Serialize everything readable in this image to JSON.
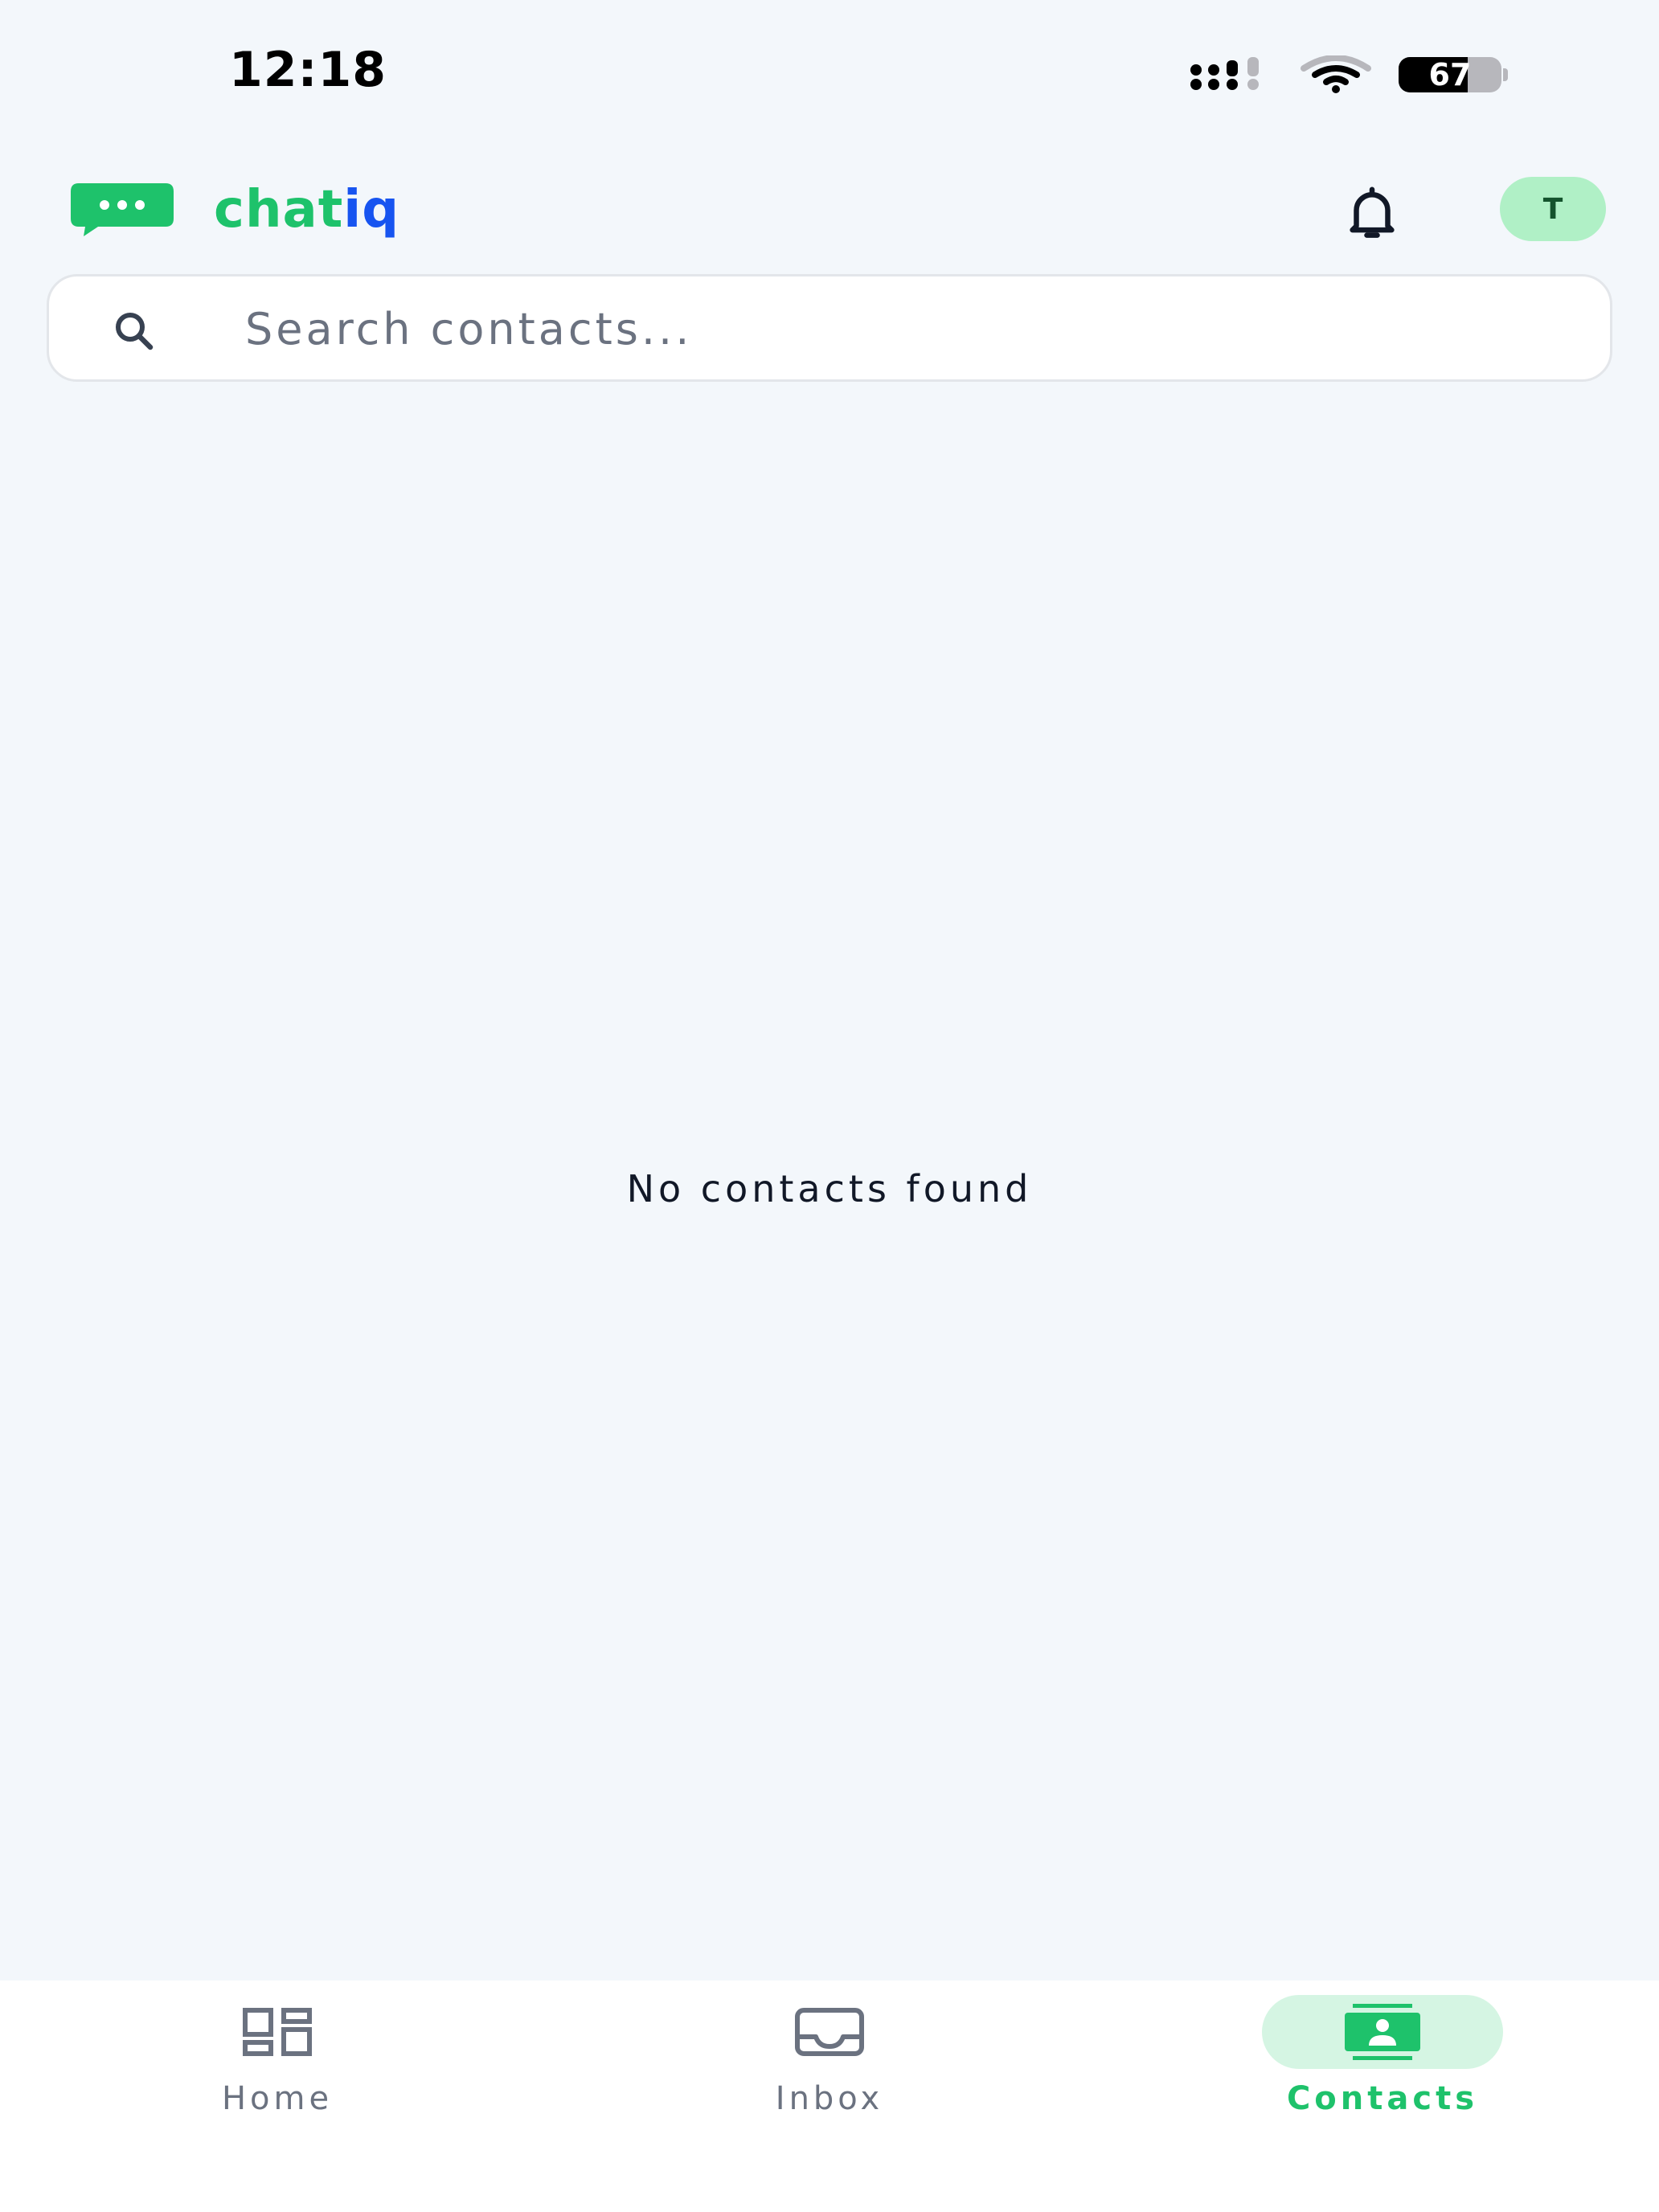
{
  "status_bar": {
    "time": "12:18",
    "battery_level": "67",
    "battery_fraction": 0.67,
    "icons": [
      "cellular-signal-icon",
      "wifi-icon",
      "battery-icon"
    ]
  },
  "header": {
    "brand_primary": "chat",
    "brand_accent": "iq",
    "logo_icon": "chat-bubble-icon",
    "notification_icon": "bell-icon",
    "avatar_initial": "T"
  },
  "search": {
    "icon": "search-icon",
    "placeholder": "Search contacts...",
    "value": ""
  },
  "main": {
    "empty_message": "No contacts found"
  },
  "bottom_nav": {
    "items": [
      {
        "label": "Home",
        "icon": "dashboard-icon",
        "active": false
      },
      {
        "label": "Inbox",
        "icon": "inbox-icon",
        "active": false
      },
      {
        "label": "Contacts",
        "icon": "contact-card-icon",
        "active": true
      }
    ]
  },
  "colors": {
    "brand_green": "#1ec26b",
    "brand_blue": "#1754f0",
    "background": "#f3f7fb",
    "avatar_bg": "#b0f0c6",
    "active_pill": "#d5f5e3",
    "inactive_text": "#6b7280"
  }
}
